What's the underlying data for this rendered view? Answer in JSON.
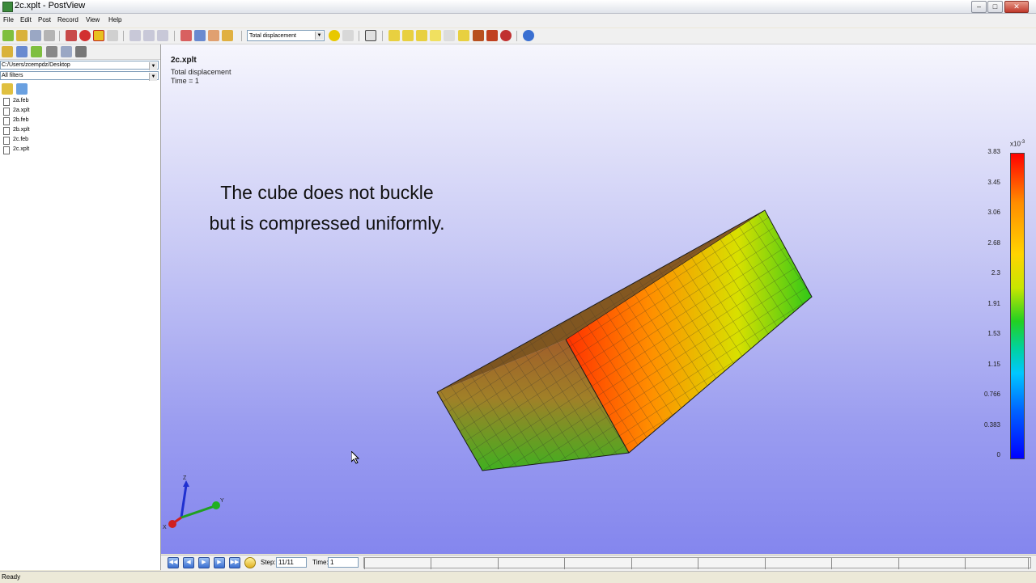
{
  "window": {
    "title": "2c.xplt - PostView"
  },
  "menu": {
    "items": [
      "File",
      "Edit",
      "Post",
      "Record",
      "View",
      "Help"
    ]
  },
  "toolbar": {
    "field_select": "Total displacement"
  },
  "sidebar": {
    "path": "C:/Users/zcempdz/Desktop",
    "filter": "All filters",
    "files": [
      "2a.feb",
      "2a.xplt",
      "2b.feb",
      "2b.xplt",
      "2c.feb",
      "2c.xplt"
    ]
  },
  "viewport": {
    "title": "2c.xplt",
    "subtitle": "Total displacement",
    "time_label": "Time = 1",
    "caption_line1": "The cube does not buckle",
    "caption_line2": "but is compressed uniformly."
  },
  "legend": {
    "exponent_base": "x10",
    "exponent_power": "-3",
    "labels": [
      "3.83",
      "3.45",
      "3.06",
      "2.68",
      "2.3",
      "1.91",
      "1.53",
      "1.15",
      "0.766",
      "0.383",
      "0"
    ]
  },
  "triad": {
    "x": "X",
    "y": "Y",
    "z": "Z"
  },
  "animation": {
    "step_label": "Step:",
    "step_value": "11/11",
    "time_label": "Time:",
    "time_value": "1"
  },
  "status": {
    "text": "Ready"
  },
  "colors": {
    "legend_top": "#ff0000",
    "legend_bottom": "#0000ff",
    "viewport_bottom": "#8486ee"
  }
}
